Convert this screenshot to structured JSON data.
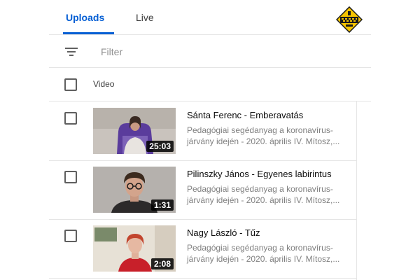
{
  "tabs": [
    {
      "label": "Uploads",
      "active": true
    },
    {
      "label": "Live",
      "active": false
    }
  ],
  "filter": {
    "placeholder": "Filter",
    "value": ""
  },
  "table_header": {
    "column_label": "Video"
  },
  "videos": [
    {
      "title": "Sánta Ferenc - Emberavatás",
      "description_line1": "Pedagógiai segédanyag a koronavírus-",
      "description_line2": "járvány idején - 2020. április IV. Mítosz,...",
      "duration": "25:03"
    },
    {
      "title": "Pilinszky János - Egyenes labirintus",
      "description_line1": "Pedagógiai segédanyag a koronavírus-",
      "description_line2": "járvány idején - 2020. április IV. Mítosz,...",
      "duration": "1:31"
    },
    {
      "title": "Nagy László - Tűz",
      "description_line1": "Pedagógiai segédanyag a koronavírus-",
      "description_line2": "járvány idején - 2020. április IV. Mítosz,...",
      "duration": "2:08"
    }
  ],
  "colors": {
    "accent": "#065fd4",
    "divider": "#e5e5e5",
    "secondary_text": "#808080"
  },
  "icons": {
    "filter": "filter-lines-icon",
    "logo": "diamond-logo-icon",
    "checkbox": "checkbox-icon"
  }
}
